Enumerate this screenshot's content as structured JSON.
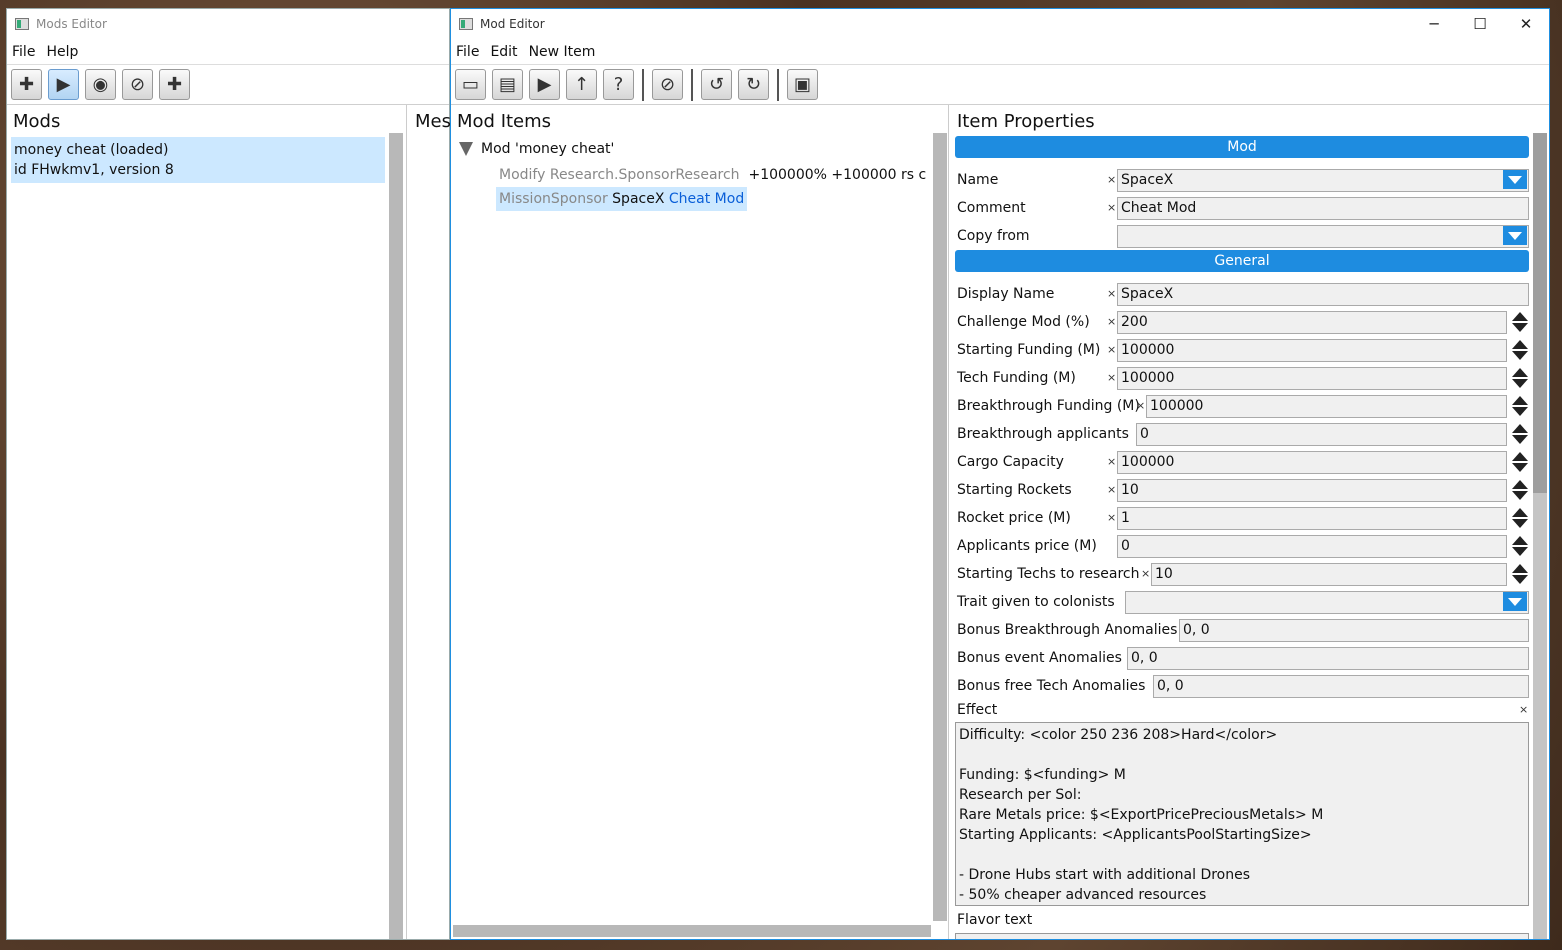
{
  "mods_editor": {
    "title": "Mods Editor",
    "menu": [
      "File",
      "Help"
    ],
    "toolbar_icons": [
      "new-mod-icon",
      "play-icon",
      "eye-icon",
      "disable-icon",
      "new-item-icon"
    ],
    "panel_title": "Mods",
    "second_panel_title": "Mes",
    "mod_line1": "money cheat (loaded)",
    "mod_line2": "id FHwkmv1, version 8"
  },
  "mod_editor": {
    "title": "Mod Editor",
    "window_controls": [
      "─",
      "☐",
      "✕"
    ],
    "menu": [
      "File",
      "Edit",
      "New Item"
    ],
    "toolbar_icons": [
      "save-icon",
      "window-icon",
      "play-icon",
      "upload-icon",
      "help-icon",
      "disable-icon",
      "undo-icon",
      "redo-icon",
      "panel-icon"
    ],
    "items_title": "Mod Items",
    "tree_root": "Mod 'money cheat'",
    "tree_item1_class": "Modify Research.SponsorResearch",
    "tree_item1_value": "+100000% +100000 rs c",
    "tree_item2_class": "MissionSponsor",
    "tree_item2_name": "SpaceX",
    "tree_item2_comment": "Cheat Mod",
    "props_title": "Item Properties",
    "section_mod": "Mod",
    "section_general": "General",
    "name_label": "Name",
    "name_value": "SpaceX",
    "comment_label": "Comment",
    "comment_value": "Cheat Mod",
    "copy_label": "Copy from",
    "copy_value": "",
    "display_label": "Display Name",
    "display_value": "SpaceX",
    "challenge_label": "Challenge Mod (%)",
    "challenge_value": "200",
    "funding_label": "Starting Funding (M)",
    "funding_value": "100000",
    "tech_label": "Tech Funding (M)",
    "tech_value": "100000",
    "bfund_label": "Breakthrough Funding (M)",
    "bfund_value": "100000",
    "bapp_label": "Breakthrough applicants",
    "bapp_value": "0",
    "cargo_label": "Cargo Capacity",
    "cargo_value": "100000",
    "rockets_label": "Starting Rockets",
    "rockets_value": "10",
    "rprice_label": "Rocket price (M)",
    "rprice_value": "1",
    "aprice_label": "Applicants price (M)",
    "aprice_value": "0",
    "techs_label": "Starting Techs to research",
    "techs_value": "10",
    "trait_label": "Trait given to colonists",
    "trait_value": "",
    "bba_label": "Bonus Breakthrough Anomalies",
    "bba_value": "0, 0",
    "bea_label": "Bonus event Anomalies",
    "bea_value": "0, 0",
    "bfta_label": "Bonus free Tech Anomalies",
    "bfta_value": "0, 0",
    "effect_label": "Effect",
    "effect_text": "Difficulty: <color 250 236 208>Hard</color>\n\nFunding: $<funding> M\nResearch per Sol:\nRare Metals price: $<ExportPricePreciousMetals> M\nStarting Applicants: <ApplicantsPoolStartingSize>\n\n- Drone Hubs start with additional Drones\n- 50% cheaper advanced resources",
    "flavor_label": "Flavor text",
    "clear_mark": "×"
  }
}
